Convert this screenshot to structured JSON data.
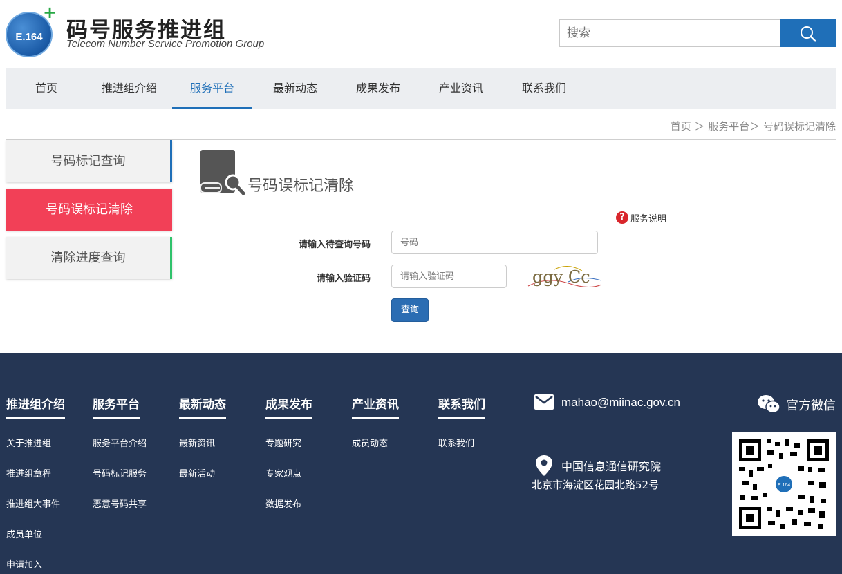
{
  "brand": {
    "logo_text": "E.164",
    "logo_plus": "+",
    "name_cn": "码号服务推进组",
    "name_en": "Telecom Number Service  Promotion Group"
  },
  "search": {
    "placeholder": "搜索",
    "icon": "search-icon"
  },
  "nav": {
    "items": [
      "首页",
      "推进组介绍",
      "服务平台",
      "最新动态",
      "成果发布",
      "产业资讯",
      "联系我们"
    ],
    "active": "服务平台"
  },
  "breadcrumb": "首页 ＞ 服务平台＞ 号码误标记清除",
  "sidebar": {
    "items": [
      {
        "label": "号码标记查询",
        "accent": "#1f6fb8"
      },
      {
        "label": "号码误标记清除",
        "accent": "#f24057"
      },
      {
        "label": "清除进度查询",
        "accent": "#2fc26b"
      }
    ],
    "active": "号码误标记清除"
  },
  "main": {
    "title": "号码误标记清除",
    "help_label": "服务说明",
    "phone_label": "请输入待查询号码",
    "phone_placeholder": "号码",
    "captcha_label": "请输入验证码",
    "captcha_placeholder": "请输入验证码",
    "captcha_text": "ggy Cc",
    "submit_label": "查询"
  },
  "footer": {
    "columns": [
      {
        "heading": "推进组介绍",
        "links": [
          "关于推进组",
          "推进组章程",
          "推进组大事件",
          "成员单位",
          "申请加入"
        ]
      },
      {
        "heading": "服务平台",
        "links": [
          "服务平台介绍",
          "号码标记服务",
          "恶意号码共享"
        ]
      },
      {
        "heading": "最新动态",
        "links": [
          "最新资讯",
          "最新活动"
        ]
      },
      {
        "heading": "成果发布",
        "links": [
          "专题研究",
          "专家观点",
          "数据发布"
        ]
      },
      {
        "heading": "产业资讯",
        "links": [
          "成员动态"
        ]
      },
      {
        "heading": "联系我们",
        "links": [
          "联系我们"
        ]
      }
    ],
    "email": "mahao@miinac.gov.cn",
    "wechat_label": "官方微信",
    "org": "中国信息通信研究院",
    "address": "北京市海淀区花园北路52号",
    "qr_center_text": "E.164"
  },
  "colors": {
    "brand_blue": "#1f6fb8",
    "active_red": "#f24057",
    "footer_bg": "#253654",
    "nav_bg": "#eceef1"
  }
}
